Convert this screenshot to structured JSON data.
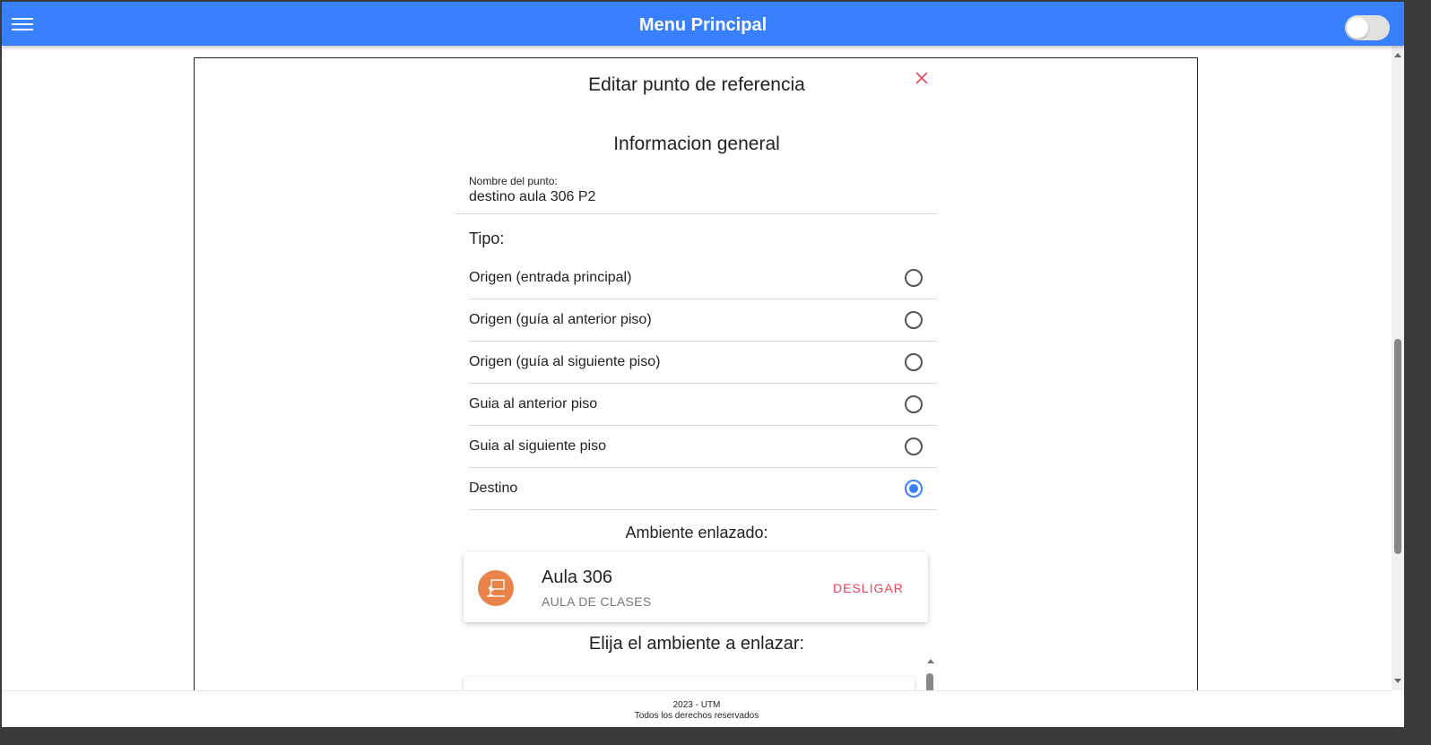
{
  "header": {
    "title": "Menu Principal",
    "menu_icon": "hamburger-menu-icon",
    "theme_toggle_on": false
  },
  "modal": {
    "title": "Editar punto de referencia",
    "close_icon": "close-icon",
    "section_title": "Informacion general",
    "name_field": {
      "label": "Nombre del punto:",
      "value": "destino aula 306 P2"
    },
    "type_label": "Tipo:",
    "type_options": [
      {
        "label": "Origen (entrada principal)",
        "checked": false
      },
      {
        "label": "Origen (guía al anterior piso)",
        "checked": false
      },
      {
        "label": "Origen (guía al siguiente piso)",
        "checked": false
      },
      {
        "label": "Guia al anterior piso",
        "checked": false
      },
      {
        "label": "Guia al siguiente piso",
        "checked": false
      },
      {
        "label": "Destino",
        "checked": true
      }
    ],
    "linked_env_title": "Ambiente enlazado:",
    "linked_env": {
      "name": "Aula 306",
      "type": "AULA DE CLASES",
      "icon": "classroom-icon",
      "avatar_color": "#e8834a",
      "unlink_label": "DESLIGAR"
    },
    "choose_env_title": "Elija el ambiente a enlazar:"
  },
  "footer": {
    "line1": "2023 - UTM",
    "line2": "Todos los derechos reservados"
  },
  "colors": {
    "primary": "#3880ff",
    "danger": "#eb445a"
  }
}
